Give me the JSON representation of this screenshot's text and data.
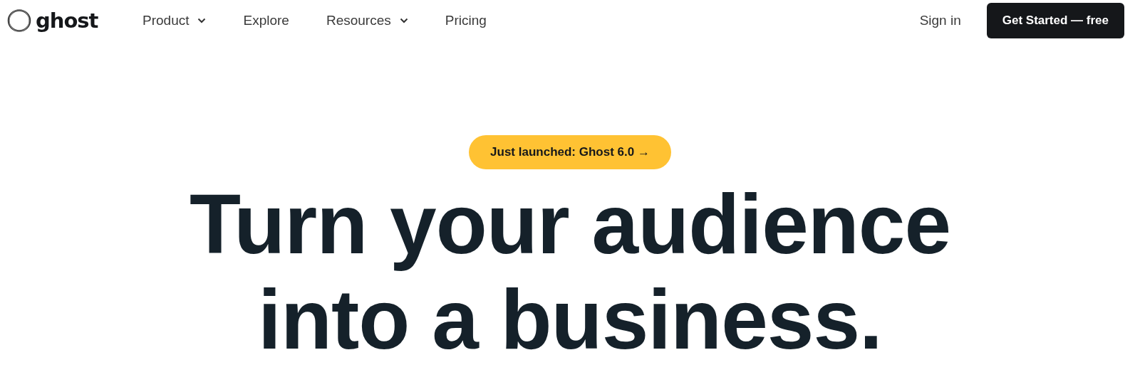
{
  "brand": {
    "name": "ghost"
  },
  "nav": [
    {
      "label": "Product",
      "has_menu": true
    },
    {
      "label": "Explore",
      "has_menu": false
    },
    {
      "label": "Resources",
      "has_menu": true
    },
    {
      "label": "Pricing",
      "has_menu": false
    }
  ],
  "sign_in": "Sign in",
  "cta": "Get Started — free",
  "announcement": "Just launched: Ghost 6.0 →",
  "headline": [
    "Turn your audience",
    "into a business."
  ]
}
